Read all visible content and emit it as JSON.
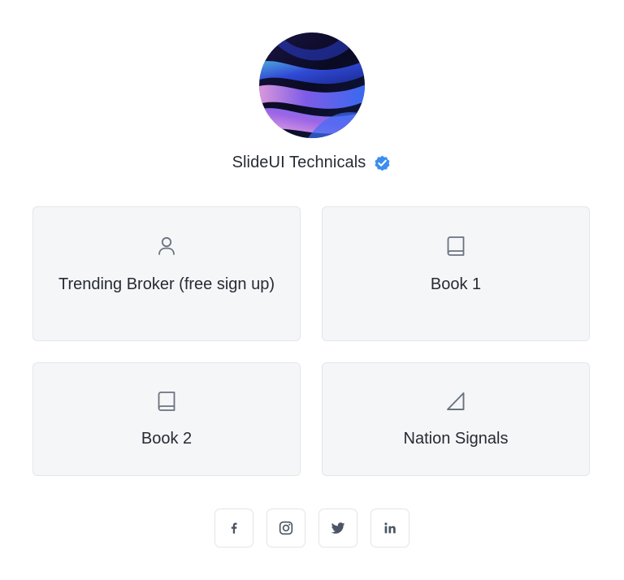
{
  "profile": {
    "name": "SlideUI Technicals",
    "verified": true,
    "accent_color": "#3b8ef0"
  },
  "links": [
    {
      "label": "Trending Broker (free sign up)",
      "icon": "user-icon"
    },
    {
      "label": "Book 1",
      "icon": "book-icon"
    },
    {
      "label": "Book 2",
      "icon": "book-icon"
    },
    {
      "label": "Nation Signals",
      "icon": "triangle-signal-icon"
    }
  ],
  "social": [
    {
      "network": "facebook",
      "icon": "facebook-icon"
    },
    {
      "network": "instagram",
      "icon": "instagram-icon"
    },
    {
      "network": "twitter",
      "icon": "twitter-icon"
    },
    {
      "network": "linkedin",
      "icon": "linkedin-icon"
    }
  ],
  "colors": {
    "card_background": "#f5f6f8",
    "card_border": "#e4e6ea",
    "icon_gray": "#6b7280",
    "text": "#262b33"
  }
}
